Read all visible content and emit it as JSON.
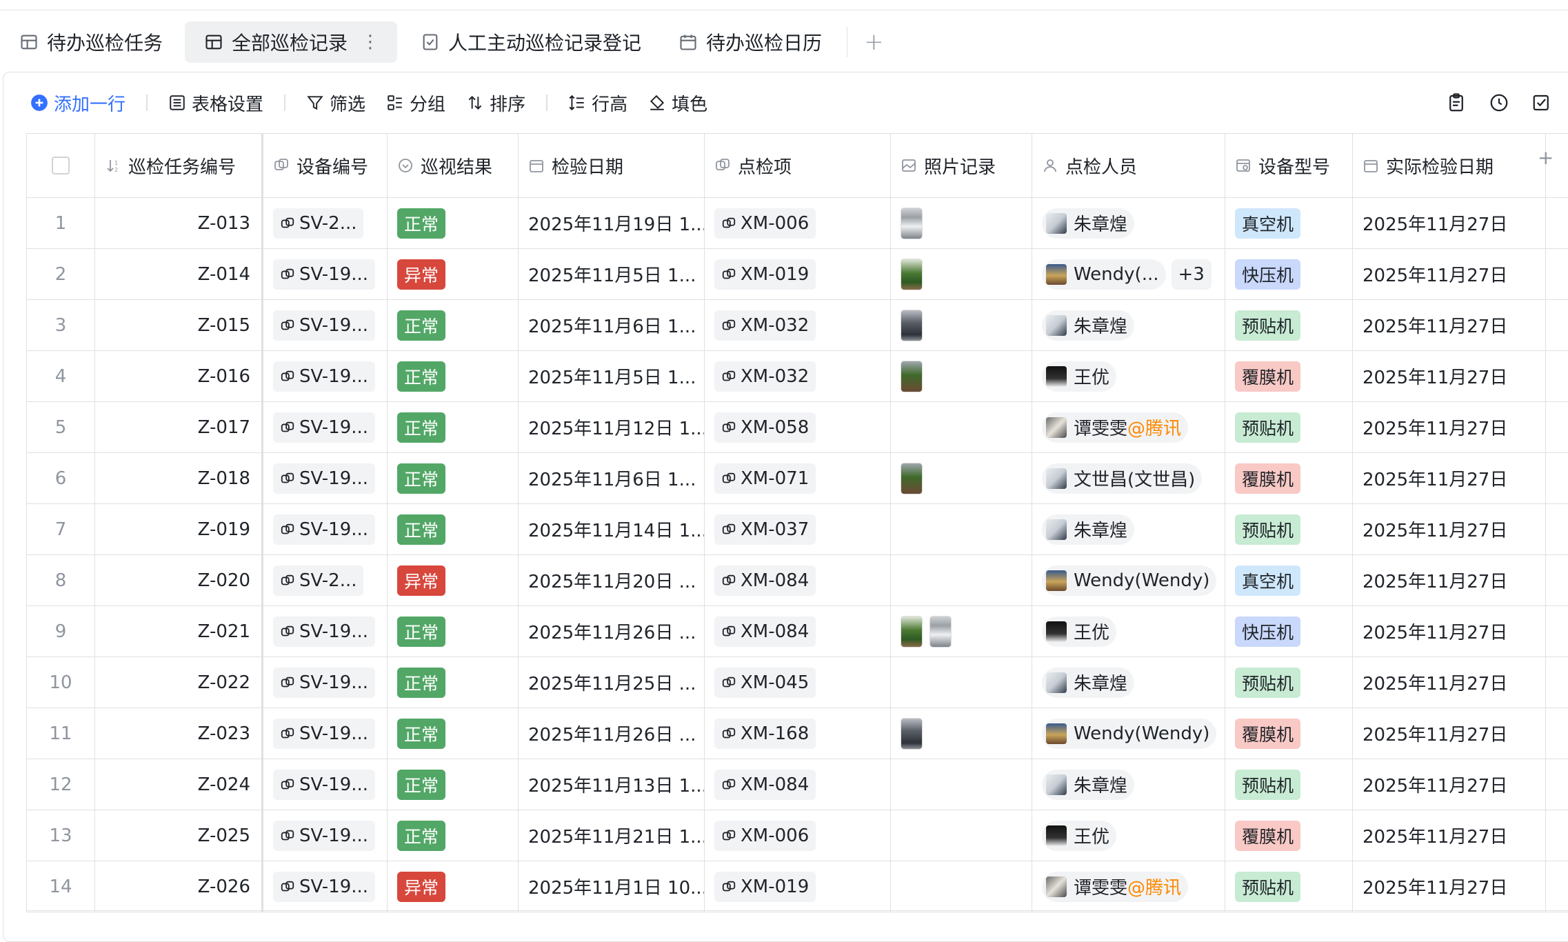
{
  "tabs": [
    {
      "label": "待办巡检任务",
      "icon": "grid-table-icon",
      "active": false
    },
    {
      "label": "全部巡检记录",
      "icon": "grid-table-icon",
      "active": true
    },
    {
      "label": "人工主动巡检记录登记",
      "icon": "form-icon",
      "active": false
    },
    {
      "label": "待办巡检日历",
      "icon": "calendar-icon",
      "active": false
    }
  ],
  "toolbar": {
    "add_row": "添加一行",
    "table_settings": "表格设置",
    "filter": "筛选",
    "group": "分组",
    "sort": "排序",
    "row_height": "行高",
    "fill_color": "填色"
  },
  "columns": {
    "task_no": "巡检任务编号",
    "device_no": "设备编号",
    "result": "巡视结果",
    "check_date": "检验日期",
    "item": "点检项",
    "photos": "照片记录",
    "inspector": "点检人员",
    "model": "设备型号",
    "actual_date": "实际检验日期"
  },
  "colors": {
    "ok": "#52a766",
    "bad": "#d8473c",
    "vacuum": "#cfe7fb",
    "press": "#c9d8fb",
    "prestick": "#c7ebd3",
    "laminate": "#f9c9c5",
    "accent": "#3370ff"
  },
  "rows": [
    {
      "n": "1",
      "task": "Z-013",
      "device": "SV-2...",
      "result": "正常",
      "status": "ok",
      "date": "2025年11月19日 1...",
      "item": "XM-006",
      "photos": [
        "machine"
      ],
      "person": "朱章煌",
      "avatar": "person-avatar",
      "plus": "",
      "model": "真空机",
      "model_key": "vacuum",
      "actual": "2025年11月27日"
    },
    {
      "n": "2",
      "task": "Z-014",
      "device": "SV-19...",
      "result": "异常",
      "status": "bad",
      "date": "2025年11月5日 1...",
      "item": "XM-019",
      "photos": [
        "plant"
      ],
      "person": "Wendy(...",
      "avatar": "landscape-avatar",
      "plus": "+3",
      "model": "快压机",
      "model_key": "press",
      "actual": "2025年11月27日"
    },
    {
      "n": "3",
      "task": "Z-015",
      "device": "SV-19...",
      "result": "正常",
      "status": "ok",
      "date": "2025年11月6日 1...",
      "item": "XM-032",
      "photos": [
        "dark"
      ],
      "person": "朱章煌",
      "avatar": "person-avatar",
      "plus": "",
      "model": "预贴机",
      "model_key": "prestick",
      "actual": "2025年11月27日"
    },
    {
      "n": "4",
      "task": "Z-016",
      "device": "SV-19...",
      "result": "正常",
      "status": "ok",
      "date": "2025年11月5日 1...",
      "item": "XM-032",
      "photos": [
        "pot"
      ],
      "person": "王优",
      "avatar": "dark-avatar",
      "plus": "",
      "model": "覆膜机",
      "model_key": "laminate",
      "actual": "2025年11月27日"
    },
    {
      "n": "5",
      "task": "Z-017",
      "device": "SV-19...",
      "result": "正常",
      "status": "ok",
      "date": "2025年11月12日 1...",
      "item": "XM-058",
      "photos": [],
      "person": "谭雯雯",
      "at": "@腾讯",
      "avatar": "cat-avatar",
      "plus": "",
      "model": "预贴机",
      "model_key": "prestick",
      "actual": "2025年11月27日"
    },
    {
      "n": "6",
      "task": "Z-018",
      "device": "SV-19...",
      "result": "正常",
      "status": "ok",
      "date": "2025年11月6日 1...",
      "item": "XM-071",
      "photos": [
        "pot"
      ],
      "person": "文世昌(文世昌)",
      "avatar": "person-avatar",
      "plus": "",
      "model": "覆膜机",
      "model_key": "laminate",
      "actual": "2025年11月27日"
    },
    {
      "n": "7",
      "task": "Z-019",
      "device": "SV-19...",
      "result": "正常",
      "status": "ok",
      "date": "2025年11月14日 1...",
      "item": "XM-037",
      "photos": [],
      "person": "朱章煌",
      "avatar": "person-avatar",
      "plus": "",
      "model": "预贴机",
      "model_key": "prestick",
      "actual": "2025年11月27日"
    },
    {
      "n": "8",
      "task": "Z-020",
      "device": "SV-2...",
      "result": "异常",
      "status": "bad",
      "date": "2025年11月20日 ...",
      "item": "XM-084",
      "photos": [],
      "person": "Wendy(Wendy)",
      "avatar": "landscape-avatar",
      "plus": "",
      "model": "真空机",
      "model_key": "vacuum",
      "actual": "2025年11月27日"
    },
    {
      "n": "9",
      "task": "Z-021",
      "device": "SV-19...",
      "result": "正常",
      "status": "ok",
      "date": "2025年11月26日 ...",
      "item": "XM-084",
      "photos": [
        "plant",
        "machine"
      ],
      "person": "王优",
      "avatar": "dark-avatar",
      "plus": "",
      "model": "快压机",
      "model_key": "press",
      "actual": "2025年11月27日"
    },
    {
      "n": "10",
      "task": "Z-022",
      "device": "SV-19...",
      "result": "正常",
      "status": "ok",
      "date": "2025年11月25日 ...",
      "item": "XM-045",
      "photos": [],
      "person": "朱章煌",
      "avatar": "person-avatar",
      "plus": "",
      "model": "预贴机",
      "model_key": "prestick",
      "actual": "2025年11月27日"
    },
    {
      "n": "11",
      "task": "Z-023",
      "device": "SV-19...",
      "result": "正常",
      "status": "ok",
      "date": "2025年11月26日 ...",
      "item": "XM-168",
      "photos": [
        "dark"
      ],
      "person": "Wendy(Wendy)",
      "avatar": "landscape-avatar",
      "plus": "",
      "model": "覆膜机",
      "model_key": "laminate",
      "actual": "2025年11月27日"
    },
    {
      "n": "12",
      "task": "Z-024",
      "device": "SV-19...",
      "result": "正常",
      "status": "ok",
      "date": "2025年11月13日 1...",
      "item": "XM-084",
      "photos": [],
      "person": "朱章煌",
      "avatar": "person-avatar",
      "plus": "",
      "model": "预贴机",
      "model_key": "prestick",
      "actual": "2025年11月27日"
    },
    {
      "n": "13",
      "task": "Z-025",
      "device": "SV-19...",
      "result": "正常",
      "status": "ok",
      "date": "2025年11月21日 1...",
      "item": "XM-006",
      "photos": [],
      "person": "王优",
      "avatar": "dark-avatar",
      "plus": "",
      "model": "覆膜机",
      "model_key": "laminate",
      "actual": "2025年11月27日"
    },
    {
      "n": "14",
      "task": "Z-026",
      "device": "SV-19...",
      "result": "异常",
      "status": "bad",
      "date": "2025年11月1日 10...",
      "item": "XM-019",
      "photos": [],
      "person": "谭雯雯",
      "at": "@腾讯",
      "avatar": "cat-avatar",
      "plus": "",
      "model": "预贴机",
      "model_key": "prestick",
      "actual": "2025年11月27日"
    }
  ]
}
